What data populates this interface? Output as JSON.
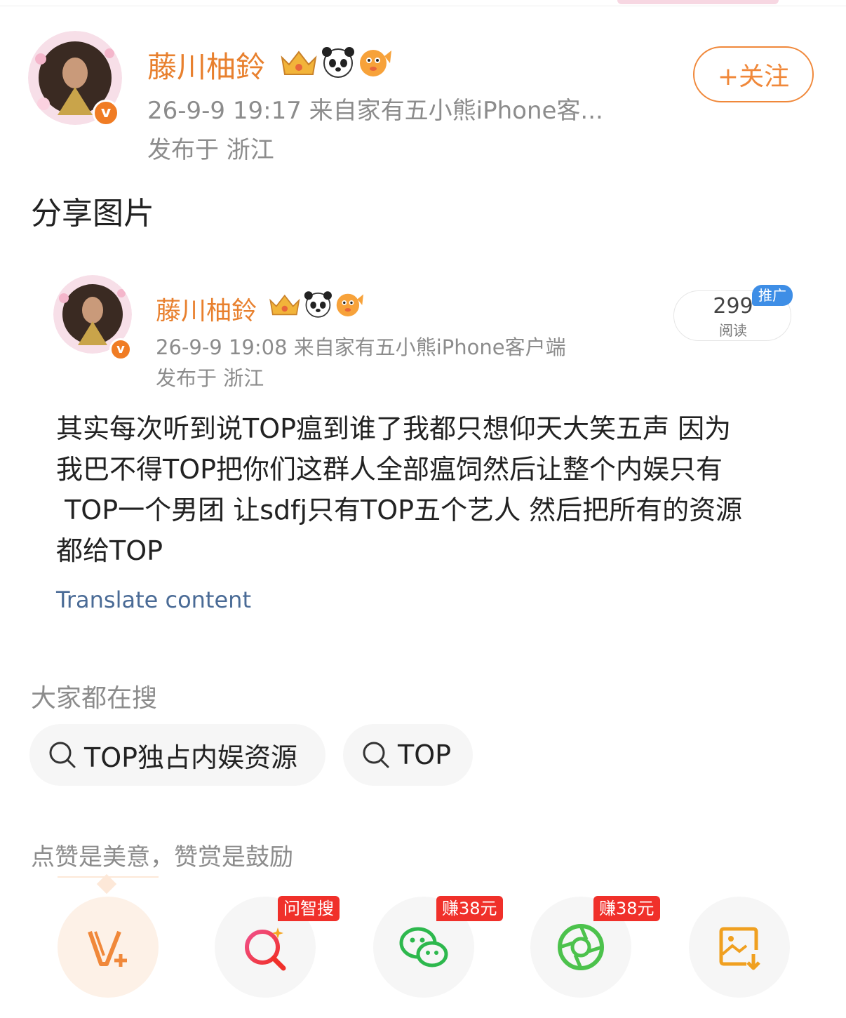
{
  "author": {
    "name": "藤川柚鈴",
    "time_and_source": "26-9-9 19:17  来自家有五小熊iPhone客...",
    "location": "发布于 浙江",
    "follow_label": "+关注"
  },
  "post": {
    "text": "分享图片"
  },
  "quoted": {
    "name": "藤川柚鈴",
    "time_and_source": "26-9-9 19:08  来自家有五小熊iPhone客户端",
    "location": "发布于 浙江",
    "reads_count": "299",
    "reads_label": "阅读",
    "promo_label": "推广",
    "body_lines": [
      "其实每次听到说TOP瘟到谁了我都只想仰天大笑五声 因为",
      "我巴不得TOP把你们这群人全部瘟饲然后让整个内娱只有",
      " TOP一个男团 让sdfj只有TOP五个艺人 然后把所有的资源",
      "都给TOP"
    ],
    "translate_label": "Translate content"
  },
  "trending": {
    "label": "大家都在搜",
    "searches": [
      "TOP独占内娱资源",
      "TOP"
    ]
  },
  "tip_label": "点赞是美意，赞赏是鼓励",
  "actions": [
    {
      "icon": "vip-reward-icon",
      "tag": ""
    },
    {
      "icon": "ai-search-icon",
      "tag": "问智搜"
    },
    {
      "icon": "wechat-icon",
      "tag": "赚38元"
    },
    {
      "icon": "moments-icon",
      "tag": "赚38元"
    },
    {
      "icon": "save-image-icon",
      "tag": ""
    }
  ],
  "colors": {
    "accent": "#f0883a",
    "username": "#e8802e",
    "link": "#4a6b96",
    "badge_red": "#f0302a",
    "promo_blue": "#3e8ee6"
  }
}
